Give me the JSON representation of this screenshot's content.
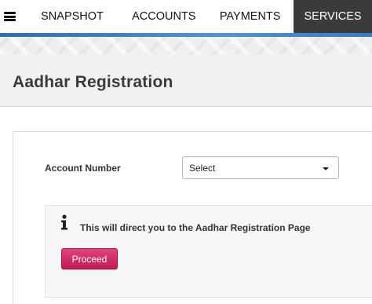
{
  "nav": {
    "menu_icon": "hamburger-menu-icon",
    "tabs": [
      {
        "label": "SNAPSHOT",
        "active": false
      },
      {
        "label": "ACCOUNTS",
        "active": false
      },
      {
        "label": "PAYMENTS",
        "active": false
      },
      {
        "label": "SERVICES",
        "active": true
      }
    ],
    "accent_color": "#3a7bbd",
    "active_tab_color": "#3b3b3b"
  },
  "page": {
    "title": "Aadhar Registration"
  },
  "form": {
    "account_label": "Account Number",
    "account_select_value": "Select"
  },
  "info": {
    "icon": "info-icon",
    "message": "This will direct you to the Aadhar Registration Page",
    "proceed_label": "Proceed",
    "button_color": "#c21858"
  }
}
